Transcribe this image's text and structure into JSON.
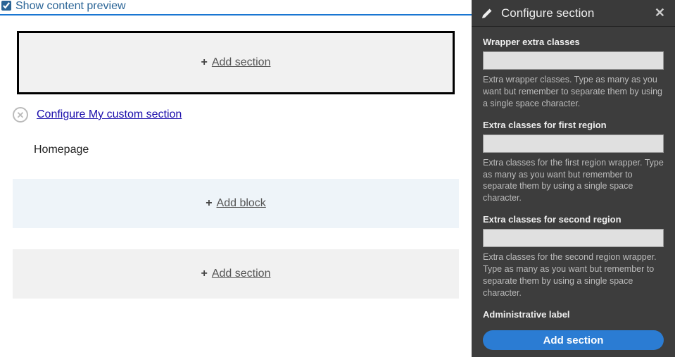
{
  "preview": {
    "checkbox_checked": true,
    "label": "Show content preview"
  },
  "layout": {
    "add_section_hero_label": "Add section",
    "remove_icon_text": "✕",
    "configure_link": "Configure My custom section",
    "page_title": "Homepage",
    "add_block_label": "Add block",
    "add_section_label": "Add section"
  },
  "panel": {
    "title": "Configure section",
    "close": "✕",
    "fields": {
      "wrapper": {
        "label": "Wrapper extra classes",
        "value": "",
        "desc": "Extra wrapper classes. Type as many as you want but remember to separate them by using a single space character."
      },
      "first": {
        "label": "Extra classes for first region",
        "value": "",
        "desc": "Extra classes for the first region wrapper. Type as many as you want but remember to separate them by using a single space character."
      },
      "second": {
        "label": "Extra classes for second region",
        "value": "",
        "desc": "Extra classes for the second region wrapper. Type as many as you want but remember to separate them by using a single space character."
      },
      "admin": {
        "label": "Administrative label",
        "value": ""
      }
    },
    "submit_label": "Add section"
  }
}
